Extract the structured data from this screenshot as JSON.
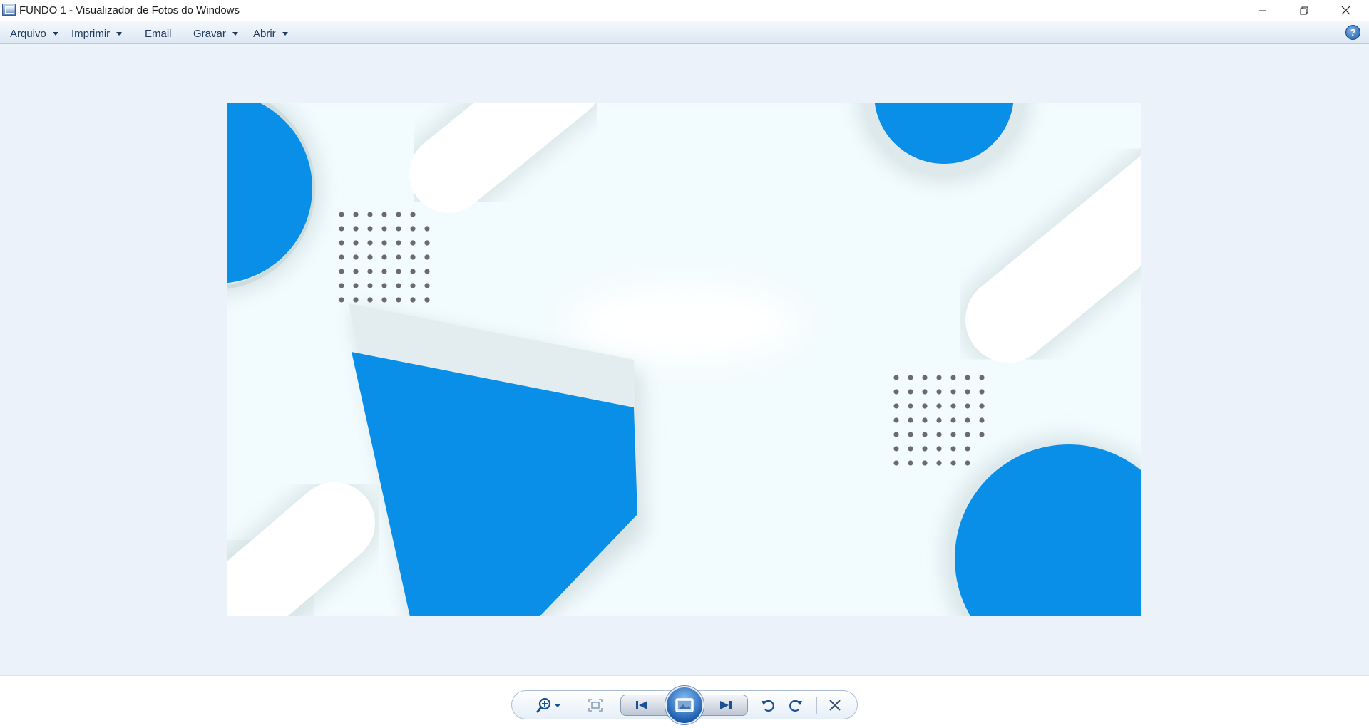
{
  "window": {
    "title": "FUNDO 1 - Visualizador de Fotos do Windows"
  },
  "menu": {
    "items": [
      "Arquivo",
      "Imprimir",
      "Email",
      "Gravar",
      "Abrir"
    ],
    "help_label": "?"
  },
  "controls": {
    "zoom": "zoom-in-icon",
    "fit": "actual-size-icon",
    "previous": "previous-icon",
    "slideshow": "slideshow-icon",
    "next": "next-icon",
    "rotate_left": "rotate-counterclockwise-icon",
    "rotate_right": "rotate-clockwise-icon",
    "delete": "delete-icon"
  },
  "colors": {
    "accent_blue": "#0a8fe8",
    "viewer_background": "#ebf2f9",
    "menubar": "#dce7f3",
    "dots": "#6b6b6b"
  }
}
